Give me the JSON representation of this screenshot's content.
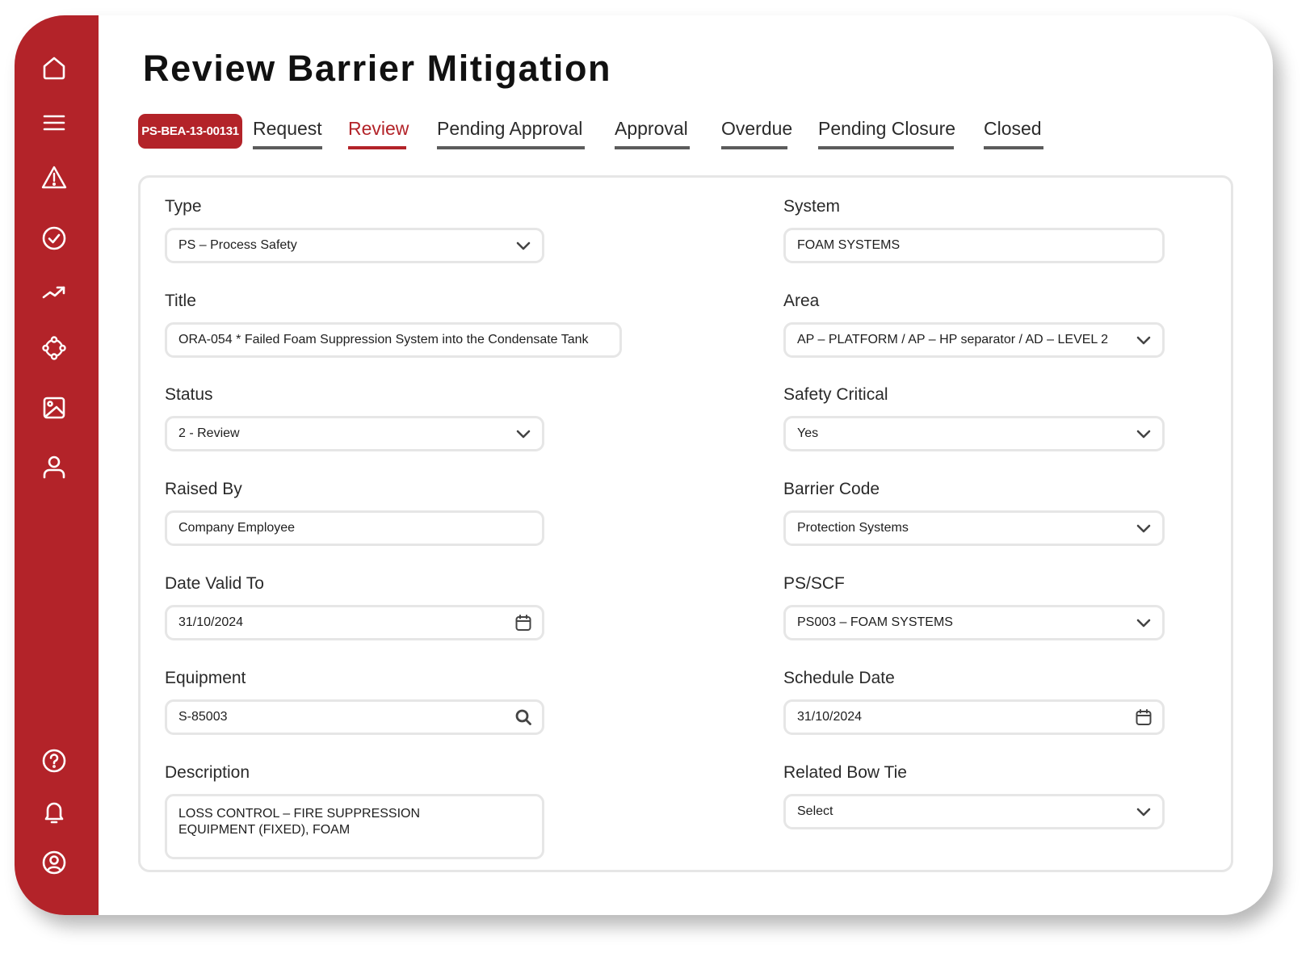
{
  "page": {
    "title": "Review Barrier Mitigation",
    "record_id": "PS-BEA-13-00131"
  },
  "theme": {
    "accent": "#b32329",
    "tab_inactive_bar": "#5c5c5c",
    "border": "#e6e6e6"
  },
  "sidebar": {
    "top_items": [
      {
        "icon": "home-icon",
        "label": "Home"
      },
      {
        "icon": "menu-icon",
        "label": "Menu"
      },
      {
        "icon": "warning-icon",
        "label": "Alerts"
      },
      {
        "icon": "check-circle-icon",
        "label": "Tasks"
      },
      {
        "icon": "trend-up-icon",
        "label": "Trends"
      },
      {
        "icon": "network-icon",
        "label": "Network"
      },
      {
        "icon": "image-icon",
        "label": "Media"
      },
      {
        "icon": "user-icon",
        "label": "Users"
      }
    ],
    "bottom_items": [
      {
        "icon": "help-icon",
        "label": "Help"
      },
      {
        "icon": "bell-icon",
        "label": "Notifications"
      },
      {
        "icon": "account-icon",
        "label": "Account"
      }
    ]
  },
  "tabs": [
    {
      "label": "Request",
      "active": false
    },
    {
      "label": "Review",
      "active": true
    },
    {
      "label": "Pending Approval",
      "active": false
    },
    {
      "label": "Approval",
      "active": false
    },
    {
      "label": "Overdue",
      "active": false
    },
    {
      "label": "Pending Closure",
      "active": false
    },
    {
      "label": "Closed",
      "active": false
    }
  ],
  "form": {
    "type": {
      "label": "Type",
      "value": "PS – Process Safety",
      "control": "select"
    },
    "title": {
      "label": "Title",
      "value": "ORA-054 * Failed Foam Suppression System into the Condensate Tank",
      "control": "text"
    },
    "status": {
      "label": "Status",
      "value": "2 - Review",
      "control": "select"
    },
    "raised_by": {
      "label": "Raised By",
      "value": "Company Employee",
      "control": "text"
    },
    "date_valid_to": {
      "label": "Date Valid To",
      "value": "31/10/2024",
      "control": "date"
    },
    "equipment": {
      "label": "Equipment",
      "value": "S-85003",
      "control": "search"
    },
    "description": {
      "label": "Description",
      "lines": [
        "LOSS CONTROL – FIRE SUPPRESSION",
        "EQUIPMENT (FIXED), FOAM"
      ],
      "control": "textarea"
    },
    "system": {
      "label": "System",
      "value": "FOAM SYSTEMS",
      "control": "text"
    },
    "area": {
      "label": "Area",
      "value": "AP – PLATFORM / AP – HP separator / AD – LEVEL 2",
      "control": "select"
    },
    "safety_critical": {
      "label": "Safety Critical",
      "value": "Yes",
      "control": "select"
    },
    "barrier_code": {
      "label": "Barrier Code",
      "value": "Protection Systems",
      "control": "select"
    },
    "ps_scf": {
      "label": "PS/SCF",
      "value": "PS003 – FOAM SYSTEMS",
      "control": "select"
    },
    "schedule_date": {
      "label": "Schedule Date",
      "value": "31/10/2024",
      "control": "date"
    },
    "related_bow_tie": {
      "label": "Related Bow Tie",
      "value": "Select",
      "control": "select"
    }
  }
}
